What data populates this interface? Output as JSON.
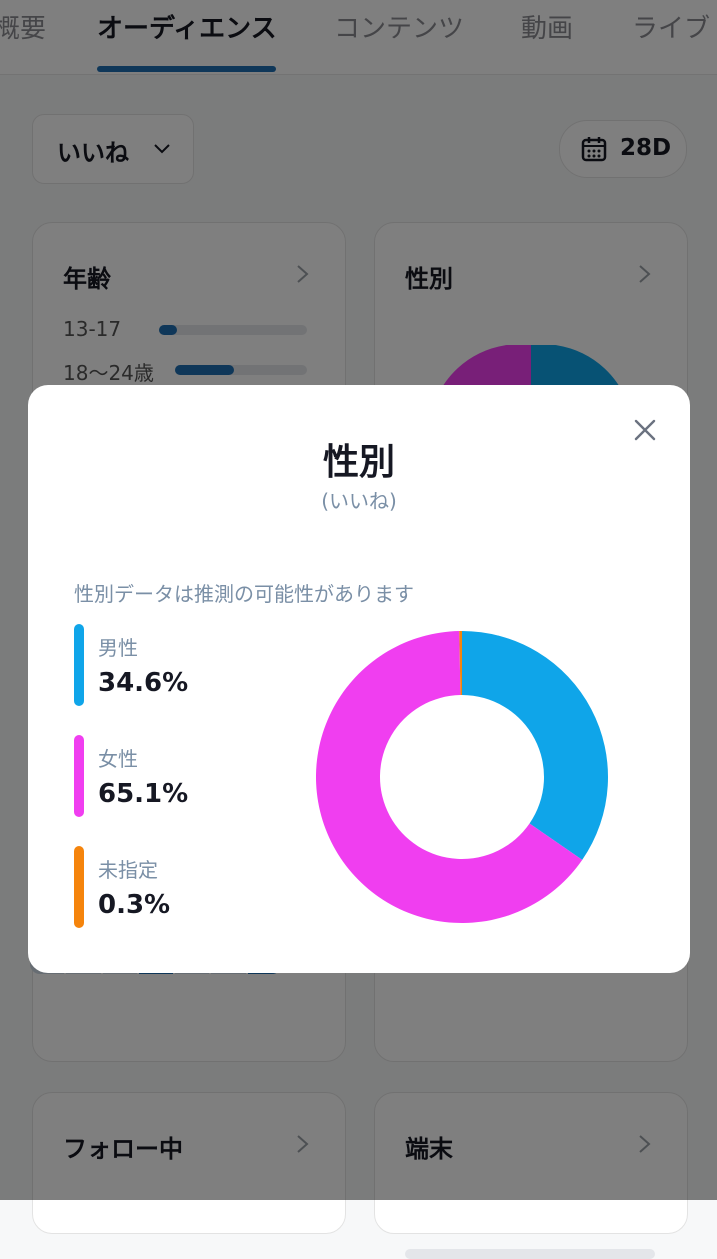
{
  "tabs": [
    "概要",
    "オーディエンス",
    "コンテンツ",
    "動画",
    "ライブ"
  ],
  "filter": {
    "metric": "いいね",
    "date_range": "28D"
  },
  "age_card": {
    "title": "年齢",
    "rows": [
      {
        "label": "13-17",
        "fraction": 0.12
      },
      {
        "label": "18～24歳",
        "fraction": 0.45
      }
    ]
  },
  "gender_card": {
    "title": "性別"
  },
  "following_card": {
    "title": "フォロー中"
  },
  "device_card": {
    "title": "端末"
  },
  "modal": {
    "title": "性別",
    "subtitle": "(いいね)",
    "note": "性別データは推測の可能性があります",
    "legend": [
      {
        "name": "男性",
        "value": "34.6%",
        "color": "#0fa5e9"
      },
      {
        "name": "女性",
        "value": "65.1%",
        "color": "#f03ef0"
      },
      {
        "name": "未指定",
        "value": "0.3%",
        "color": "#f5840c"
      }
    ]
  },
  "chart_data": {
    "type": "pie",
    "title": "性別",
    "categories": [
      "男性",
      "女性",
      "未指定"
    ],
    "values": [
      34.6,
      65.1,
      0.3
    ],
    "colors": [
      "#0fa5e9",
      "#f03ef0",
      "#f5840c"
    ],
    "legend": "left"
  }
}
